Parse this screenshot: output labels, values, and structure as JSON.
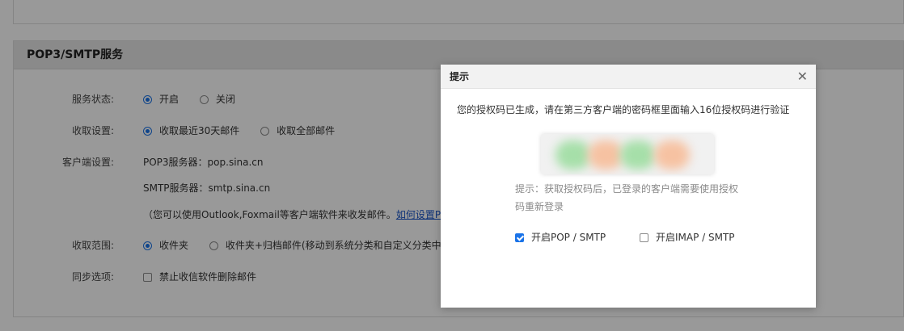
{
  "section": {
    "title": "POP3/SMTP服务"
  },
  "settings": {
    "service_status": {
      "label": "服务状态:",
      "options": [
        "开启",
        "关闭"
      ],
      "selected": "开启"
    },
    "receive_setting": {
      "label": "收取设置:",
      "options": [
        "收取最近30天邮件",
        "收取全部邮件"
      ],
      "selected": "收取最近30天邮件"
    },
    "client_setting": {
      "label": "客户端设置:",
      "pop3": "POP3服务器：pop.sina.cn",
      "smtp": "SMTP服务器：smtp.sina.cn",
      "note": "（您可以使用Outlook,Foxmail等客户端软件来收发邮件。",
      "link": "如何设置PO"
    },
    "receive_range": {
      "label": "收取范围:",
      "options": [
        "收件夹",
        "收件夹+归档邮件(移动到系统分类和自定义分类中的"
      ],
      "selected": "收件夹"
    },
    "sync_option": {
      "label": "同步选项:",
      "checkbox": "禁止收信软件删除邮件",
      "checked": false
    }
  },
  "dialog": {
    "title": "提示",
    "close_icon": "close-icon",
    "message": "您的授权码已生成，请在第三方客户端的密码框里面输入16位授权码进行验证",
    "tip_line1": "提示：获取授权码后，已登录的客户端需要使用授权",
    "tip_line2": "码重新登录",
    "options": [
      {
        "label": "开启POP / SMTP",
        "checked": true
      },
      {
        "label": "开启IMAP / SMTP",
        "checked": false
      }
    ]
  },
  "colors": {
    "accent": "#1a73e8",
    "overlay": "rgba(0,0,0,0.40)"
  }
}
